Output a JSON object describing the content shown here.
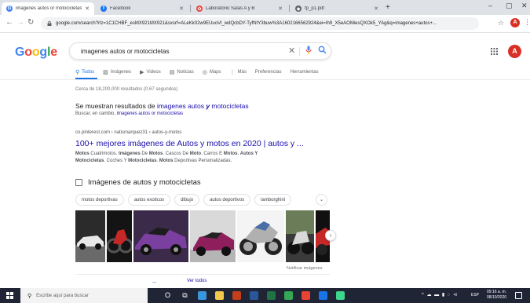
{
  "browser": {
    "tabs": [
      {
        "label": "imagenes autos or motocicletas",
        "icon": "google-g-icon",
        "color": "#4285f4",
        "glyph": "G"
      },
      {
        "label": "Facebook",
        "icon": "facebook-icon",
        "color": "#1877f2",
        "glyph": "f"
      },
      {
        "label": "Laboratorio Salas A y B",
        "icon": "lab-icon",
        "color": "#e8453c",
        "glyph": "✿"
      },
      {
        "label": "fp_p1.pdf",
        "icon": "drive-icon",
        "color": "#5f6368",
        "glyph": "◆"
      }
    ],
    "tab_close": "✕",
    "new_tab": "+",
    "window_controls": {
      "minimize": "–",
      "maximize": "▢",
      "close": "✕"
    },
    "url": "google.com/search?rlz=1C1CHBF_esMX921MX921&sxsrf=ALeKk02w9EUuoVl_wdQcbDY-TyfNtY3buw%3A1602166562924&ei=Ih9_X5eAOMiesQXOk5_YAg&q=imagenes+autos+...",
    "profile_initial": "A"
  },
  "google": {
    "logo": [
      {
        "ch": "G",
        "color": "#4285f4"
      },
      {
        "ch": "o",
        "color": "#ea4335"
      },
      {
        "ch": "o",
        "color": "#fbbc05"
      },
      {
        "ch": "g",
        "color": "#4285f4"
      },
      {
        "ch": "l",
        "color": "#34a853"
      },
      {
        "ch": "e",
        "color": "#ea4335"
      }
    ],
    "query": "imagenes autos or motocicletas",
    "clear_glyph": "✕",
    "profile_initial": "A",
    "nav_tabs": [
      {
        "label": "Todos",
        "glyph": "⚲",
        "active": true
      },
      {
        "label": "Imágenes",
        "glyph": "▨",
        "active": false
      },
      {
        "label": "Videos",
        "glyph": "▶",
        "active": false
      },
      {
        "label": "Noticias",
        "glyph": "▤",
        "active": false
      },
      {
        "label": "Maps",
        "glyph": "◎",
        "active": false
      },
      {
        "label": "Más",
        "glyph": "⋮",
        "active": false
      },
      {
        "label": "Preferencias",
        "glyph": "",
        "active": false
      },
      {
        "label": "Herramientas",
        "glyph": "",
        "active": false
      }
    ]
  },
  "results": {
    "stats": "Cerca de 18,200,000 resultados (0.67 segundos)",
    "spell_prefix": "Se muestran resultados de ",
    "spell_link_a": "imagenes autos ",
    "spell_link_y": "y",
    "spell_link_b": " motocicletas",
    "spell_alt_prefix": "Buscar, en cambio, ",
    "spell_alt_link": "imagenes autos or motocicletas",
    "first": {
      "cite": "co.pinterest.com › natismarquez31 › autos-y-motos",
      "title": "100+ mejores imágenes de Autos y motos en 2020 | autos y ...",
      "snippet_1": [
        {
          "t": "Motos",
          "b": true
        },
        {
          "t": " Cuatrimotos. ",
          "b": false
        },
        {
          "t": "Imágenes",
          "b": true
        },
        {
          "t": " De ",
          "b": false
        },
        {
          "t": "Motos",
          "b": true
        },
        {
          "t": ". Cascos De ",
          "b": false
        },
        {
          "t": "Moto",
          "b": true
        },
        {
          "t": ". Carros E ",
          "b": false
        },
        {
          "t": "Motos",
          "b": true
        },
        {
          "t": ". ",
          "b": false
        },
        {
          "t": "Autos Y",
          "b": true
        }
      ],
      "snippet_2": [
        {
          "t": "Motocicletas",
          "b": true
        },
        {
          "t": ". Coches Y ",
          "b": false
        },
        {
          "t": "Motocicletas",
          "b": true
        },
        {
          "t": ". ",
          "b": false
        },
        {
          "t": "Motos",
          "b": true
        },
        {
          "t": " Deportivas Personalizadas.",
          "b": false
        }
      ]
    },
    "images": {
      "heading": "Imágenes de autos y motocicletas",
      "chips": [
        "motos deportivas",
        "autos exoticos",
        "dibujo",
        "autos deportivos",
        "lamborghini"
      ],
      "chip_more": "⌄",
      "next_glyph": "›",
      "report": "Notificar imágenes",
      "see_all": "Ver todos",
      "see_all_arrow": "→"
    }
  },
  "taskbar": {
    "search_placeholder": "Escribe aquí para buscar",
    "tray_icons": "^ ☁ ▬ ▮ ◌ ⊲",
    "lang": "ESP",
    "time": "09:16 a. m.",
    "date": "08/10/2020",
    "apps": [
      {
        "name": "cortana-icon",
        "color": "#ffffff",
        "glyph": "O"
      },
      {
        "name": "task-view-icon",
        "color": "#ffffff",
        "glyph": "⧉"
      },
      {
        "name": "store-icon",
        "color": "#3a96dd",
        "glyph": ""
      },
      {
        "name": "files-icon",
        "color": "#f2c94c",
        "glyph": ""
      },
      {
        "name": "powerpoint-icon",
        "color": "#c43e1c",
        "glyph": ""
      },
      {
        "name": "word-icon",
        "color": "#2b579a",
        "glyph": ""
      },
      {
        "name": "excel-icon",
        "color": "#217346",
        "glyph": ""
      },
      {
        "name": "chrome-icon",
        "color": "#34a853",
        "glyph": ""
      },
      {
        "name": "chrome-2-icon",
        "color": "#ea4335",
        "glyph": ""
      },
      {
        "name": "mail-icon",
        "color": "#1a73e8",
        "glyph": ""
      },
      {
        "name": "photos-icon",
        "color": "#3dd68c",
        "glyph": ""
      }
    ]
  }
}
